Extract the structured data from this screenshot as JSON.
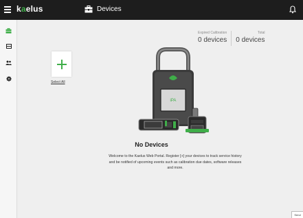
{
  "header": {
    "logo_text": "kaelus",
    "page_title": "Devices",
    "title_icon": "toolbox-icon",
    "notification_icon": "bell-icon"
  },
  "sidebar": {
    "items": [
      {
        "icon": "toolbox-icon",
        "active": true
      },
      {
        "icon": "list-icon",
        "active": false
      },
      {
        "icon": "users-icon",
        "active": false
      },
      {
        "icon": "gear-icon",
        "active": false
      }
    ]
  },
  "stats": {
    "expired_label": "Expired Calibration",
    "expired_value": "0 devices",
    "total_label": "Total",
    "total_value": "0 devices"
  },
  "add_tile": {
    "icon": "plus-icon",
    "select_all_label": "Select All"
  },
  "empty_state": {
    "title": "No Devices",
    "message": "Welcome to the Kaelus Web Portal. Register [+] your devices to track service history and be notified of upcoming events such as calibration due dates, software releases and more.",
    "device_screen_text": "iPA"
  },
  "feedback": {
    "label": "Send"
  },
  "colors": {
    "topbar": "#1d1d1d",
    "accent": "#3fae49",
    "background": "#efefef",
    "sidebar": "#f6f6f6"
  }
}
